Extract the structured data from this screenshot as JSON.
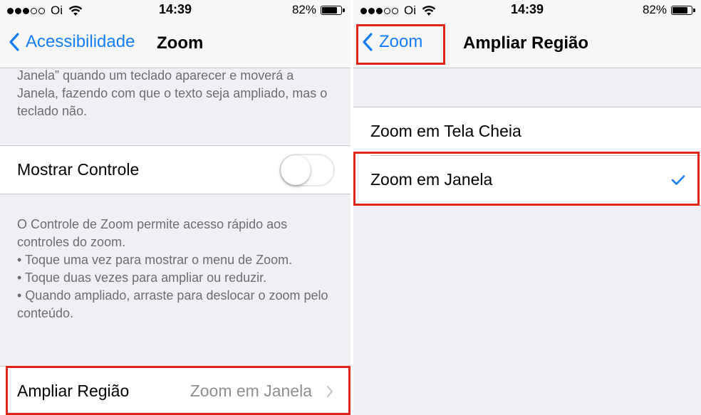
{
  "colors": {
    "accent": "#157efb",
    "highlight": "#e2231a",
    "background": "#efeff4"
  },
  "left": {
    "status": {
      "carrier": "Oi",
      "time": "14:39",
      "battery": "82%",
      "battery_level": 0.82
    },
    "nav": {
      "back_label": "Acessibilidade",
      "title": "Zoom",
      "back_icon": "chevron-left-icon"
    },
    "top_footer": "Janela” quando um teclado aparecer e moverá a Janela, fazendo com que o texto seja ampliado, mas o teclado não.",
    "show_controller": {
      "label": "Mostrar Controle",
      "on": false
    },
    "controller_footer": [
      "O Controle de Zoom permite acesso rápido aos controles do zoom.",
      "• Toque uma vez para mostrar o menu de Zoom.",
      "• Toque duas vezes para ampliar ou reduzir.",
      "• Quando ampliado, arraste para deslocar o zoom pelo conteúdo."
    ],
    "region": {
      "label": "Ampliar Região",
      "value": "Zoom em Janela",
      "icon": "chevron-right-icon"
    }
  },
  "right": {
    "status": {
      "carrier": "Oi",
      "time": "14:39",
      "battery": "82%",
      "battery_level": 0.82
    },
    "nav": {
      "back_label": "Zoom",
      "title": "Ampliar Região",
      "back_icon": "chevron-left-icon"
    },
    "options": [
      {
        "label": "Zoom em Tela Cheia",
        "selected": false
      },
      {
        "label": "Zoom em Janela",
        "selected": true
      }
    ],
    "check_icon": "checkmark-icon"
  }
}
